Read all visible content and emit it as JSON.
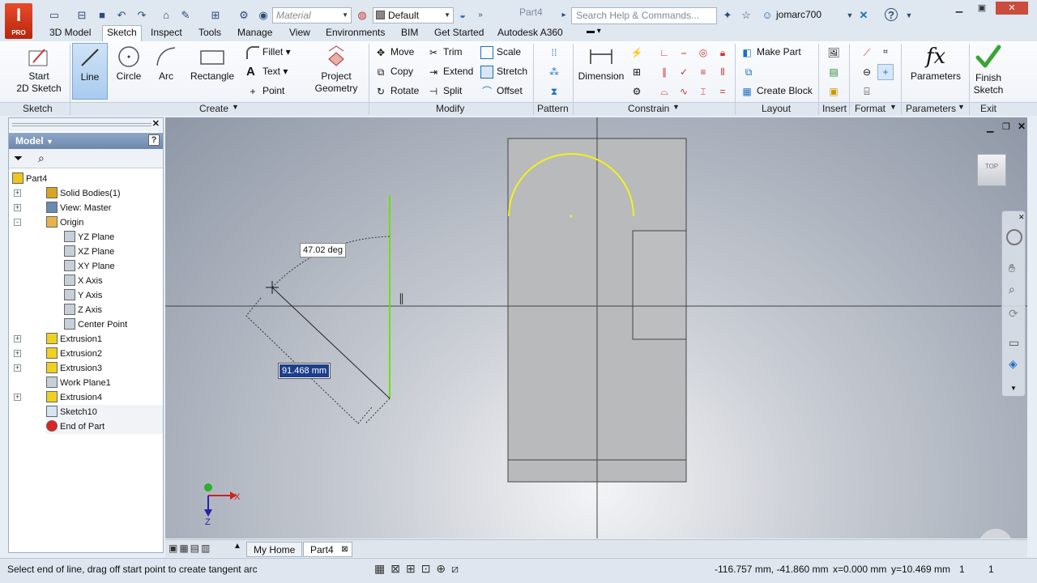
{
  "app": {
    "logo_text": "I",
    "logo_badge": "PRO",
    "document_title": "Part4"
  },
  "quick_access": {
    "material_placeholder": "Material",
    "appearance_value": "Default"
  },
  "search": {
    "placeholder": "Search Help & Commands..."
  },
  "user": {
    "name": "jomarc700"
  },
  "menu_tabs": [
    "3D Model",
    "Sketch",
    "Inspect",
    "Tools",
    "Manage",
    "View",
    "Environments",
    "BIM",
    "Get Started",
    "Autodesk A360"
  ],
  "active_tab": "Sketch",
  "ribbon": {
    "sketch": {
      "start_sketch": "Start\n2D Sketch",
      "panel": "Sketch"
    },
    "create": {
      "line": "Line",
      "circle": "Circle",
      "arc": "Arc",
      "rectangle": "Rectangle",
      "fillet": "Fillet",
      "text": "Text",
      "point": "Point",
      "project_geometry": "Project\nGeometry",
      "panel": "Create"
    },
    "modify": {
      "move": "Move",
      "copy": "Copy",
      "rotate": "Rotate",
      "trim": "Trim",
      "extend": "Extend",
      "split": "Split",
      "scale": "Scale",
      "stretch": "Stretch",
      "offset": "Offset",
      "panel": "Modify"
    },
    "pattern": {
      "panel": "Pattern"
    },
    "constrain": {
      "dimension": "Dimension",
      "panel": "Constrain"
    },
    "layout": {
      "make_part": "Make Part",
      "create_block": "Create Block",
      "panel": "Layout"
    },
    "insert": {
      "panel": "Insert"
    },
    "format": {
      "panel": "Format"
    },
    "parameters": {
      "label": "Parameters",
      "panel": "Parameters",
      "icon_text": "fx"
    },
    "exit": {
      "finish_sketch": "Finish\nSketch",
      "panel": "Exit"
    }
  },
  "browser": {
    "title": "Model",
    "help": "?",
    "items": [
      {
        "label": "Part4",
        "indent": 0,
        "icon": "part-icon"
      },
      {
        "label": "Solid Bodies(1)",
        "indent": 1,
        "icon": "solid-bodies-icon",
        "expand": "+"
      },
      {
        "label": "View: Master",
        "indent": 1,
        "icon": "view-icon",
        "expand": "+"
      },
      {
        "label": "Origin",
        "indent": 1,
        "icon": "folder-icon",
        "expand": "-"
      },
      {
        "label": "YZ Plane",
        "indent": 2,
        "icon": "plane-icon"
      },
      {
        "label": "XZ Plane",
        "indent": 2,
        "icon": "plane-icon"
      },
      {
        "label": "XY Plane",
        "indent": 2,
        "icon": "plane-icon"
      },
      {
        "label": "X Axis",
        "indent": 2,
        "icon": "axis-icon"
      },
      {
        "label": "Y Axis",
        "indent": 2,
        "icon": "axis-icon"
      },
      {
        "label": "Z Axis",
        "indent": 2,
        "icon": "axis-icon"
      },
      {
        "label": "Center Point",
        "indent": 2,
        "icon": "point-icon"
      },
      {
        "label": "Extrusion1",
        "indent": 1,
        "icon": "extrusion-icon",
        "expand": "+"
      },
      {
        "label": "Extrusion2",
        "indent": 1,
        "icon": "extrusion-icon",
        "expand": "+"
      },
      {
        "label": "Extrusion3",
        "indent": 1,
        "icon": "extrusion-icon",
        "expand": "+"
      },
      {
        "label": "Work Plane1",
        "indent": 1,
        "icon": "workplane-icon"
      },
      {
        "label": "Extrusion4",
        "indent": 1,
        "icon": "extrusion-icon",
        "expand": "+"
      },
      {
        "label": "Sketch10",
        "indent": 1,
        "icon": "sketch-icon"
      },
      {
        "label": "End of Part",
        "indent": 1,
        "icon": "end-of-part-icon"
      }
    ]
  },
  "viewport": {
    "angle_dim": "47.02 deg",
    "length_dim": "91.468 mm",
    "viewcube_top": "TOP",
    "axis_x": "X",
    "axis_z": "Z"
  },
  "doc_tabs": [
    "My Home",
    "Part4"
  ],
  "status": {
    "message": "Select end of line, drag off start point to create tangent arc",
    "coords": "-116.757 mm, -41.860 mm",
    "x_val": "x=0.000 mm",
    "y_val": "y=10.469 mm",
    "count1": "1",
    "count2": "1"
  },
  "colors": {
    "accent": "#1e6fc2",
    "sketch_yellow": "#f2f21a",
    "line_green": "#6fe000"
  }
}
